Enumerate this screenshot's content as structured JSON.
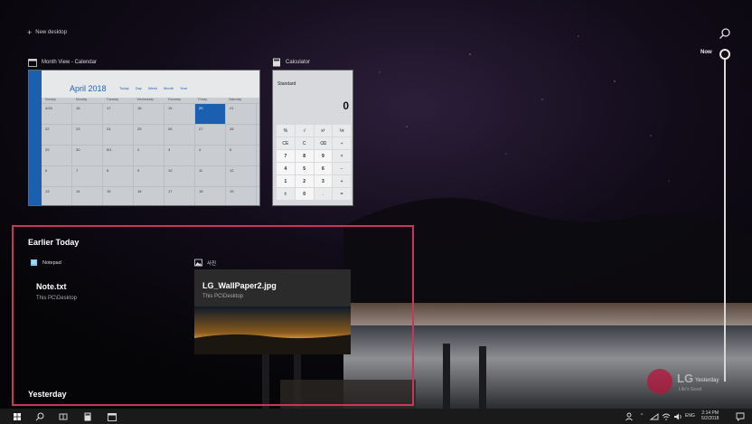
{
  "top": {
    "new_desktop_label": "New desktop"
  },
  "windows": {
    "calendar": {
      "title": "Month View - Calendar",
      "month": "April 2018",
      "toolbar": [
        "Today",
        "Day",
        "Week",
        "Month",
        "Year"
      ],
      "weekdays": [
        "Sunday",
        "Monday",
        "Tuesday",
        "Wednesday",
        "Thursday",
        "Friday",
        "Saturday"
      ],
      "weeks": [
        [
          "4/15",
          "16",
          "17",
          "18",
          "19",
          "20",
          "21"
        ],
        [
          "22",
          "23",
          "24",
          "25",
          "26",
          "27",
          "28"
        ],
        [
          "29",
          "30",
          "5/1",
          "2",
          "3",
          "4",
          "5"
        ],
        [
          "6",
          "7",
          "8",
          "9",
          "10",
          "11",
          "12"
        ],
        [
          "13",
          "14",
          "15",
          "16",
          "17",
          "18",
          "19"
        ]
      ],
      "today": "20"
    },
    "calculator": {
      "title": "Calculator",
      "mode": "Standard",
      "display": "0",
      "keys": [
        "%",
        "√",
        "x²",
        "⅟x",
        "CE",
        "C",
        "⌫",
        "÷",
        "7",
        "8",
        "9",
        "×",
        "4",
        "5",
        "6",
        "−",
        "1",
        "2",
        "3",
        "+",
        "±",
        "0",
        ".",
        "="
      ]
    }
  },
  "timeline": {
    "now_label": "Now",
    "yesterday_label": "Yesterday",
    "sections": {
      "earlier_today": "Earlier Today",
      "yesterday": "Yesterday"
    },
    "activities": [
      {
        "app": "Notepad",
        "title": "Note.txt",
        "location": "This PC\\Desktop"
      },
      {
        "app": "사진",
        "title": "LG_WallPaper2.jpg",
        "location": "This PC\\Desktop"
      }
    ]
  },
  "watermark": {
    "brand": "LG",
    "slogan": "Life's Good"
  },
  "taskbar": {
    "tray_lang": "ENG",
    "time": "2:14 PM",
    "date": "5/2/2018"
  },
  "colors": {
    "timeline_highlight": "#c8375a",
    "calendar_accent": "#1a5fb0"
  }
}
